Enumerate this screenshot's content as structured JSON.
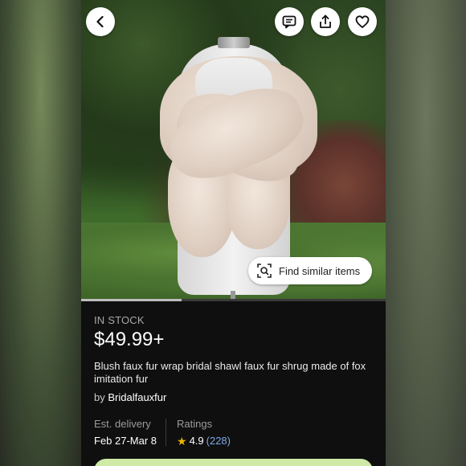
{
  "product": {
    "stock_status": "IN STOCK",
    "price": "$49.99+",
    "title": "Blush faux fur wrap bridal shawl faux fur shrug made of fox imitation fur",
    "seller_prefix": "by",
    "seller_name": "Bridalfauxfur"
  },
  "delivery": {
    "label": "Est. delivery",
    "value": "Feb 27-Mar 8"
  },
  "ratings": {
    "label": "Ratings",
    "score": "4.9",
    "count": "(228)"
  },
  "image_overlay": {
    "find_similar_label": "Find similar items"
  },
  "gallery": {
    "progress_fraction": 0.33
  },
  "icons": {
    "back": "chevron-left-icon",
    "message": "message-icon",
    "share": "share-icon",
    "favorite": "heart-icon",
    "visual_search": "visual-search-icon",
    "star": "star-icon"
  },
  "colors": {
    "background": "#0f0f0f",
    "rating_star": "#f0b400",
    "rating_count": "#7fa9ea",
    "cta": "#cfe9a6"
  }
}
